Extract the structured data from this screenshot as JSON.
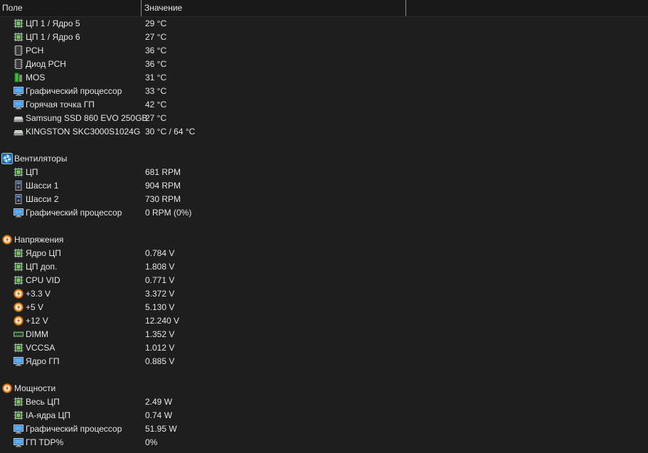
{
  "header": {
    "field": "Поле",
    "value": "Значение"
  },
  "rows": [
    {
      "kind": "child",
      "icon": "cpu-icon",
      "label": "ЦП 1 / Ядро 5",
      "value": "29 °C"
    },
    {
      "kind": "child",
      "icon": "cpu-icon",
      "label": "ЦП 1 / Ядро 6",
      "value": "27 °C"
    },
    {
      "kind": "child",
      "icon": "chip-icon",
      "label": "PCH",
      "value": "36 °C"
    },
    {
      "kind": "child",
      "icon": "chip-icon",
      "label": "Диод PCH",
      "value": "36 °C"
    },
    {
      "kind": "child",
      "icon": "battery-icon",
      "label": "MOS",
      "value": "31 °C"
    },
    {
      "kind": "child",
      "icon": "monitor-icon",
      "label": "Графический процессор",
      "value": "33 °C"
    },
    {
      "kind": "child",
      "icon": "monitor-icon",
      "label": "Горячая точка ГП",
      "value": "42 °C"
    },
    {
      "kind": "child",
      "icon": "drive-icon",
      "label": "Samsung SSD 860 EVO 250GB",
      "value": "27 °C"
    },
    {
      "kind": "child",
      "icon": "drive-icon",
      "label": "KINGSTON SKC3000S1024G",
      "value": "30 °C / 64 °C"
    },
    {
      "kind": "spacer"
    },
    {
      "kind": "group",
      "icon": "fan-icon",
      "label": "Вентиляторы"
    },
    {
      "kind": "child",
      "icon": "cpu-icon",
      "label": "ЦП",
      "value": "681 RPM"
    },
    {
      "kind": "child",
      "icon": "case-icon",
      "label": "Шасси 1",
      "value": "904 RPM"
    },
    {
      "kind": "child",
      "icon": "case-icon",
      "label": "Шасси 2",
      "value": "730 RPM"
    },
    {
      "kind": "child",
      "icon": "monitor-icon",
      "label": "Графический процессор",
      "value": "0 RPM  (0%)"
    },
    {
      "kind": "spacer"
    },
    {
      "kind": "group",
      "icon": "power-icon",
      "label": "Напряжения"
    },
    {
      "kind": "child",
      "icon": "cpu-icon",
      "label": "Ядро ЦП",
      "value": "0.784 V"
    },
    {
      "kind": "child",
      "icon": "cpu-icon",
      "label": "ЦП доп.",
      "value": "1.808 V"
    },
    {
      "kind": "child",
      "icon": "cpu-icon",
      "label": "CPU VID",
      "value": "0.771 V"
    },
    {
      "kind": "child",
      "icon": "power-icon",
      "label": "+3.3 V",
      "value": "3.372 V"
    },
    {
      "kind": "child",
      "icon": "power-icon",
      "label": "+5 V",
      "value": "5.130 V"
    },
    {
      "kind": "child",
      "icon": "power-icon",
      "label": "+12 V",
      "value": "12.240 V"
    },
    {
      "kind": "child",
      "icon": "memory-icon",
      "label": "DIMM",
      "value": "1.352 V"
    },
    {
      "kind": "child",
      "icon": "cpu-icon",
      "label": "VCCSA",
      "value": "1.012 V"
    },
    {
      "kind": "child",
      "icon": "monitor-icon",
      "label": "Ядро ГП",
      "value": "0.885 V"
    },
    {
      "kind": "spacer"
    },
    {
      "kind": "group",
      "icon": "power-icon",
      "label": "Мощности"
    },
    {
      "kind": "child",
      "icon": "cpu-icon",
      "label": "Весь ЦП",
      "value": "2.49 W"
    },
    {
      "kind": "child",
      "icon": "cpu-icon",
      "label": "IA-ядра ЦП",
      "value": "0.74 W"
    },
    {
      "kind": "child",
      "icon": "monitor-icon",
      "label": "Графический процессор",
      "value": "51.95 W"
    },
    {
      "kind": "child",
      "icon": "monitor-icon",
      "label": "ГП TDP%",
      "value": "0%"
    }
  ]
}
